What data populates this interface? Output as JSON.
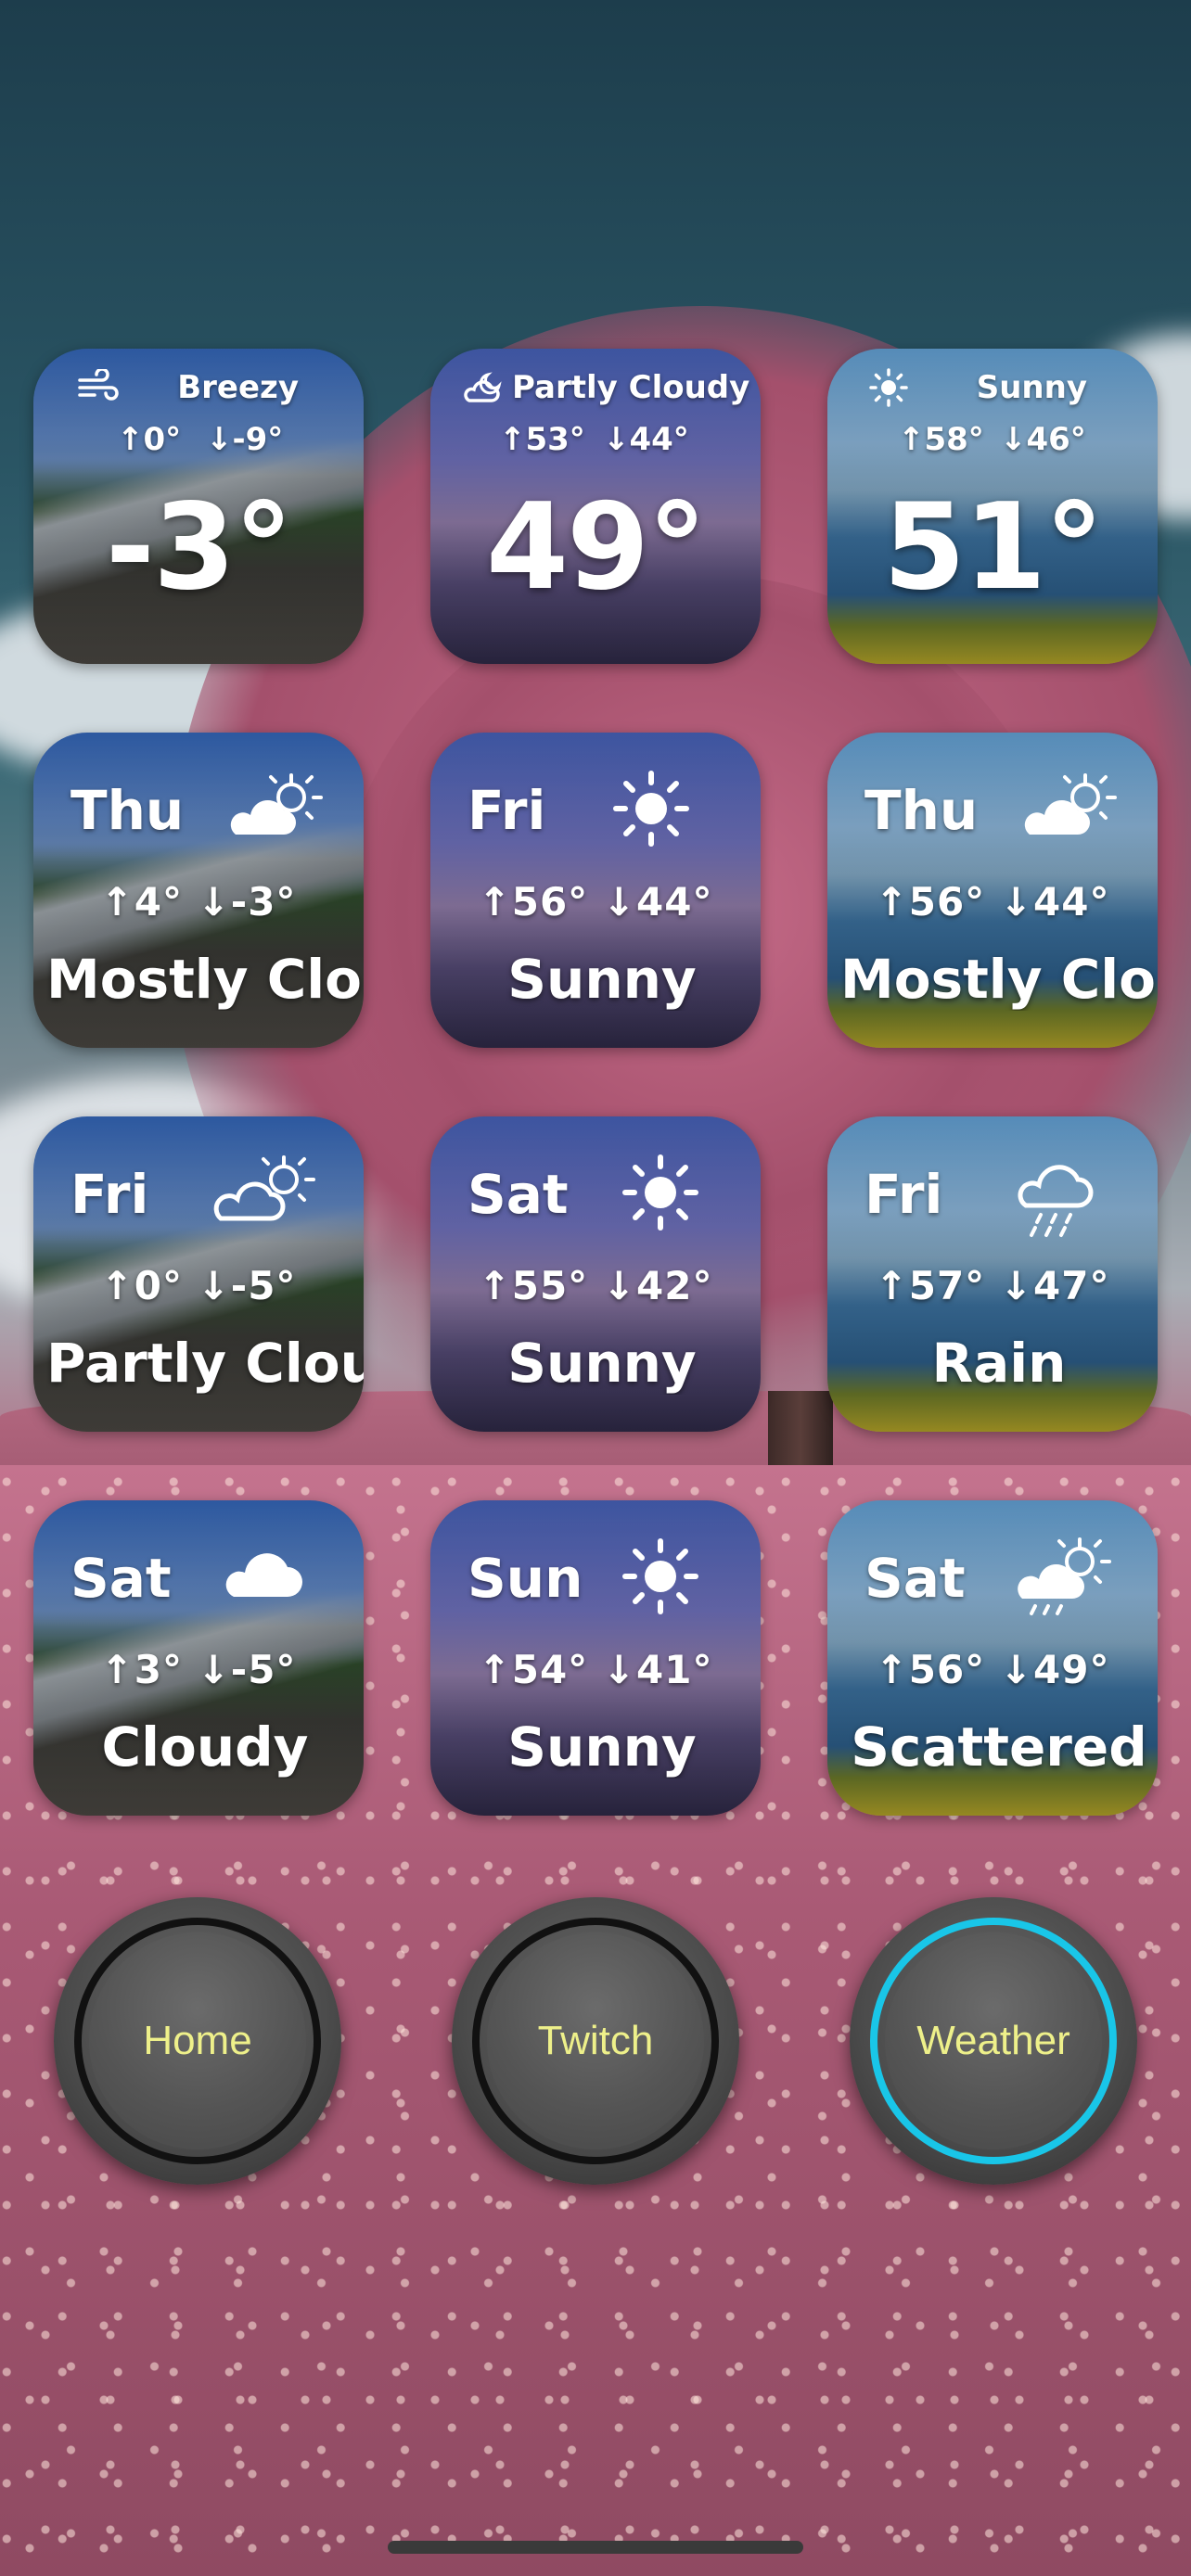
{
  "top_widgets": [
    {
      "condition": "Breezy",
      "high": "↑0°",
      "low": "↓-9°",
      "temp": "-3°",
      "icon": "wind-icon"
    },
    {
      "condition": "Partly Cloudy",
      "high": "↑53°",
      "low": "↓44°",
      "temp": "49°",
      "icon": "cloud-moon-icon"
    },
    {
      "condition": "Sunny",
      "high": "↑58°",
      "low": "↓46°",
      "temp": "51°",
      "icon": "sun-icon"
    }
  ],
  "forecast_rows": [
    [
      {
        "day": "Thu",
        "hilo": "↑4° ↓-3°",
        "desc": "Mostly Clo",
        "icon": "partly-sunny-icon"
      },
      {
        "day": "Fri",
        "hilo": "↑56° ↓44°",
        "desc": "Sunny",
        "icon": "sun-icon"
      },
      {
        "day": "Thu",
        "hilo": "↑56° ↓44°",
        "desc": "Mostly Clo",
        "icon": "partly-sunny-icon"
      }
    ],
    [
      {
        "day": "Fri",
        "hilo": "↑0° ↓-5°",
        "desc": "Partly Clou",
        "icon": "partly-sunny-outline-icon"
      },
      {
        "day": "Sat",
        "hilo": "↑55° ↓42°",
        "desc": "Sunny",
        "icon": "sun-icon"
      },
      {
        "day": "Fri",
        "hilo": "↑57° ↓47°",
        "desc": "Rain",
        "icon": "rain-icon"
      }
    ],
    [
      {
        "day": "Sat",
        "hilo": "↑3° ↓-5°",
        "desc": "Cloudy",
        "icon": "cloud-icon"
      },
      {
        "day": "Sun",
        "hilo": "↑54° ↓41°",
        "desc": "Sunny",
        "icon": "sun-icon"
      },
      {
        "day": "Sat",
        "hilo": "↑56° ↓49°",
        "desc": "Scattered",
        "icon": "sun-rain-icon"
      }
    ]
  ],
  "dock": [
    {
      "label": "Home",
      "active": false
    },
    {
      "label": "Twitch",
      "active": false
    },
    {
      "label": "Weather",
      "active": true
    }
  ],
  "colors": {
    "accent_ring": "#19c6e8",
    "button_text": "#eef08a"
  }
}
